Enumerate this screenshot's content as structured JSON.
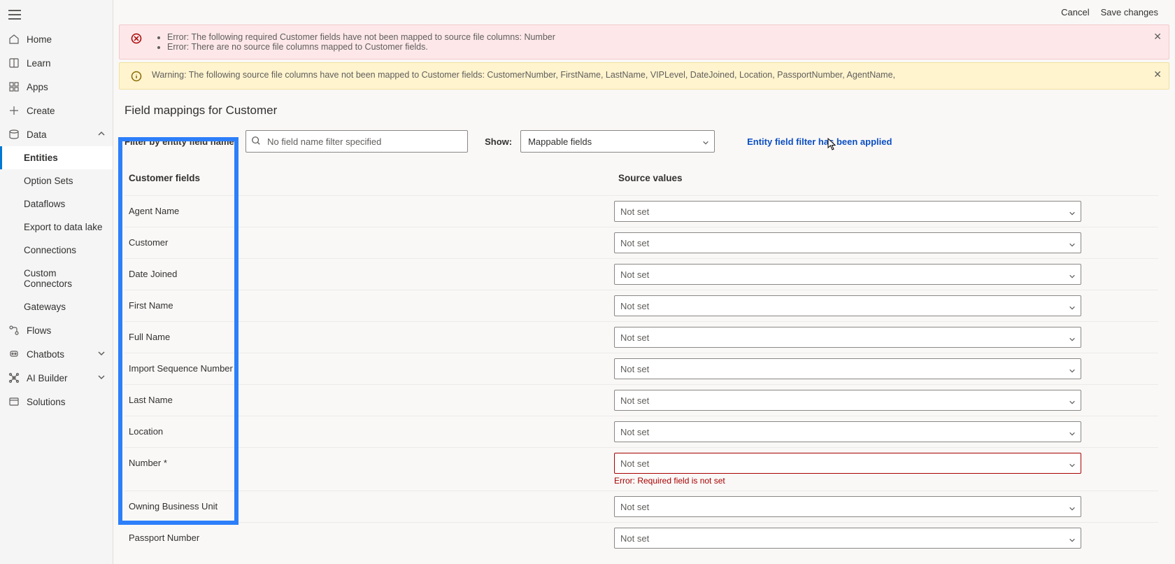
{
  "top": {
    "cancel": "Cancel",
    "save": "Save changes"
  },
  "sidebar": {
    "home": "Home",
    "learn": "Learn",
    "apps": "Apps",
    "create": "Create",
    "data": "Data",
    "entities": "Entities",
    "optionSets": "Option Sets",
    "dataflows": "Dataflows",
    "exportLake": "Export to data lake",
    "connections": "Connections",
    "customConnectors": "Custom Connectors",
    "gateways": "Gateways",
    "flows": "Flows",
    "chatbots": "Chatbots",
    "aiBuilder": "AI Builder",
    "solutions": "Solutions"
  },
  "alerts": {
    "error1": "Error: The following required Customer fields have not been mapped to source file columns: Number",
    "error2": "Error: There are no source file columns mapped to Customer fields.",
    "warning": "Warning: The following source file columns have not been mapped to Customer fields: CustomerNumber, FirstName, LastName, VIPLevel, DateJoined, Location, PassportNumber, AgentName,"
  },
  "page": {
    "title": "Field mappings for Customer",
    "filterLabel": "Filter by entity field name:",
    "filterPlaceholder": "No field name filter specified",
    "showLabel": "Show:",
    "showValue": "Mappable fields",
    "filterStatus": "Entity field filter has been applied",
    "thFields": "Customer fields",
    "thValues": "Source values",
    "notSet": "Not set",
    "rowError": "Error: Required field is not set"
  },
  "rows": [
    {
      "name": "Agent Name",
      "value": "Not set",
      "error": false,
      "required": false
    },
    {
      "name": "Customer",
      "value": "Not set",
      "error": false,
      "required": false
    },
    {
      "name": "Date Joined",
      "value": "Not set",
      "error": false,
      "required": false
    },
    {
      "name": "First Name",
      "value": "Not set",
      "error": false,
      "required": false
    },
    {
      "name": "Full Name",
      "value": "Not set",
      "error": false,
      "required": false
    },
    {
      "name": "Import Sequence Number",
      "value": "Not set",
      "error": false,
      "required": false
    },
    {
      "name": "Last Name",
      "value": "Not set",
      "error": false,
      "required": false
    },
    {
      "name": "Location",
      "value": "Not set",
      "error": false,
      "required": false
    },
    {
      "name": "Number",
      "value": "Not set",
      "error": true,
      "required": true
    },
    {
      "name": "Owning Business Unit",
      "value": "Not set",
      "error": false,
      "required": false
    },
    {
      "name": "Passport Number",
      "value": "Not set",
      "error": false,
      "required": false
    }
  ]
}
